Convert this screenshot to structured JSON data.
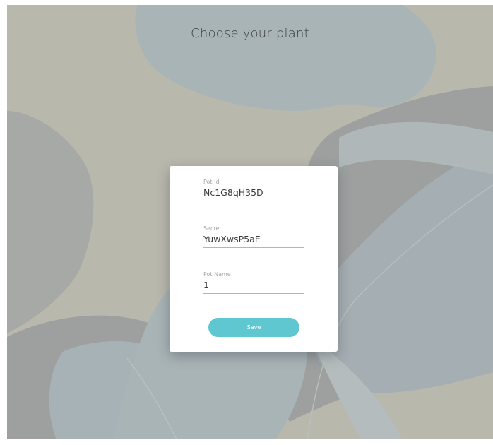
{
  "page": {
    "title": "Choose your plant"
  },
  "form": {
    "pot_id": {
      "label": "Pot Id",
      "value": "Nc1G8qH35D"
    },
    "secret": {
      "label": "Secret",
      "value": "YuwXwsP5aE"
    },
    "pot_name": {
      "label": "Pot Name",
      "value": "1"
    },
    "save_label": "Save"
  },
  "colors": {
    "background": "#b9b8ad",
    "leaf_blue": "#a9b4b6",
    "leaf_gray": "#9ea0a0",
    "button": "#5ec7cf"
  }
}
